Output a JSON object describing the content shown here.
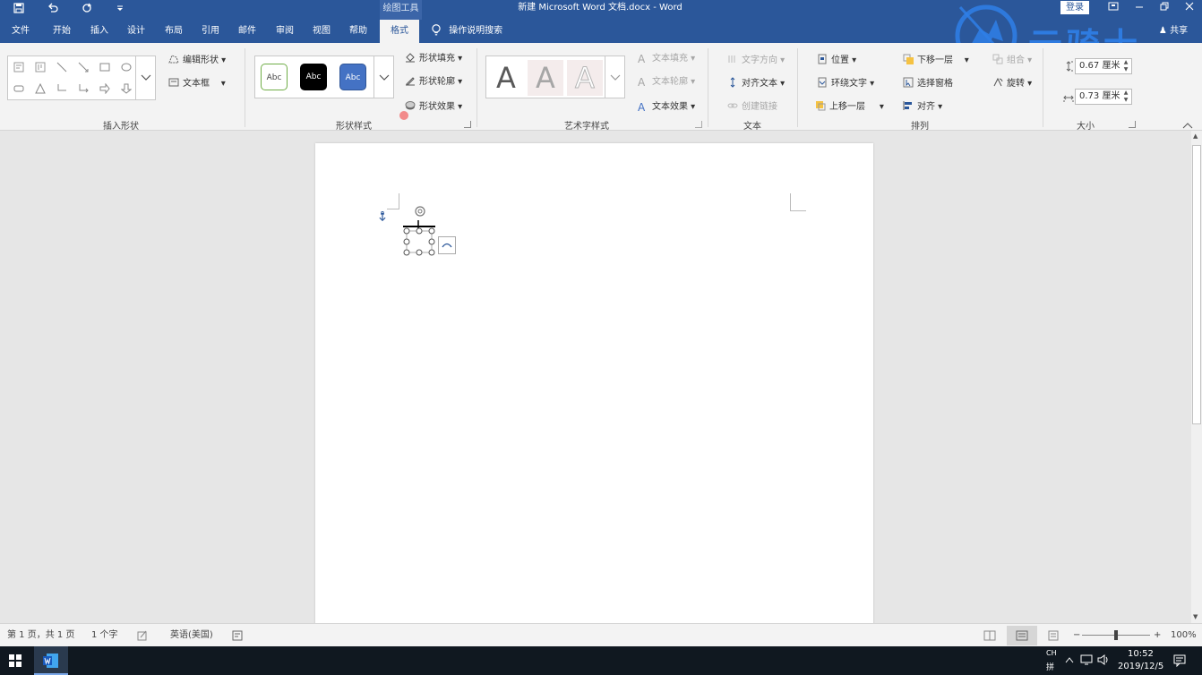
{
  "titlebar": {
    "context_tools": "绘图工具",
    "doc_title": "新建 Microsoft Word 文档.docx  -  Word",
    "login": "登录",
    "share": "共享"
  },
  "tabs": [
    "文件",
    "开始",
    "插入",
    "设计",
    "布局",
    "引用",
    "邮件",
    "审阅",
    "视图",
    "帮助",
    "格式"
  ],
  "active_tab": "格式",
  "tell_me": "操作说明搜索",
  "watermark_text": "云骑士",
  "ribbon": {
    "insert_shapes": {
      "label": "插入形状",
      "edit_shape": "编辑形状",
      "text_box": "文本框"
    },
    "shape_styles": {
      "label": "形状样式",
      "swatches": [
        "Abc",
        "Abc",
        "Abc"
      ],
      "fill": "形状填充",
      "outline": "形状轮廓",
      "effects": "形状效果"
    },
    "wordart_styles": {
      "label": "艺术字样式",
      "letters": [
        "A",
        "A",
        "A"
      ],
      "text_fill": "文本填充",
      "text_outline": "文本轮廓",
      "text_effects": "文本效果"
    },
    "text": {
      "label": "文本",
      "direction": "文字方向",
      "align_text": "对齐文本",
      "create_link": "创建链接"
    },
    "arrange": {
      "label": "排列",
      "position": "位置",
      "wrap_text": "环绕文字",
      "bring_forward": "上移一层",
      "send_backward": "下移一层",
      "selection_pane": "选择窗格",
      "align": "对齐",
      "group": "组合",
      "rotate": "旋转"
    },
    "size": {
      "label": "大小",
      "height": "0.67 厘米",
      "width": "0.73 厘米"
    }
  },
  "statusbar": {
    "page": "第 1 页，共 1 页",
    "words": "1 个字",
    "language": "英语(美国)",
    "zoom": "100%",
    "zoom_level": 1.0
  },
  "taskbar": {
    "ime_top": "CH",
    "ime_bottom": "拼",
    "time": "10:52",
    "date": "2019/12/5"
  },
  "colors": {
    "brand": "#2b579a",
    "ribbon_bg": "#f3f3f3",
    "style_blue": "#4472c4"
  }
}
